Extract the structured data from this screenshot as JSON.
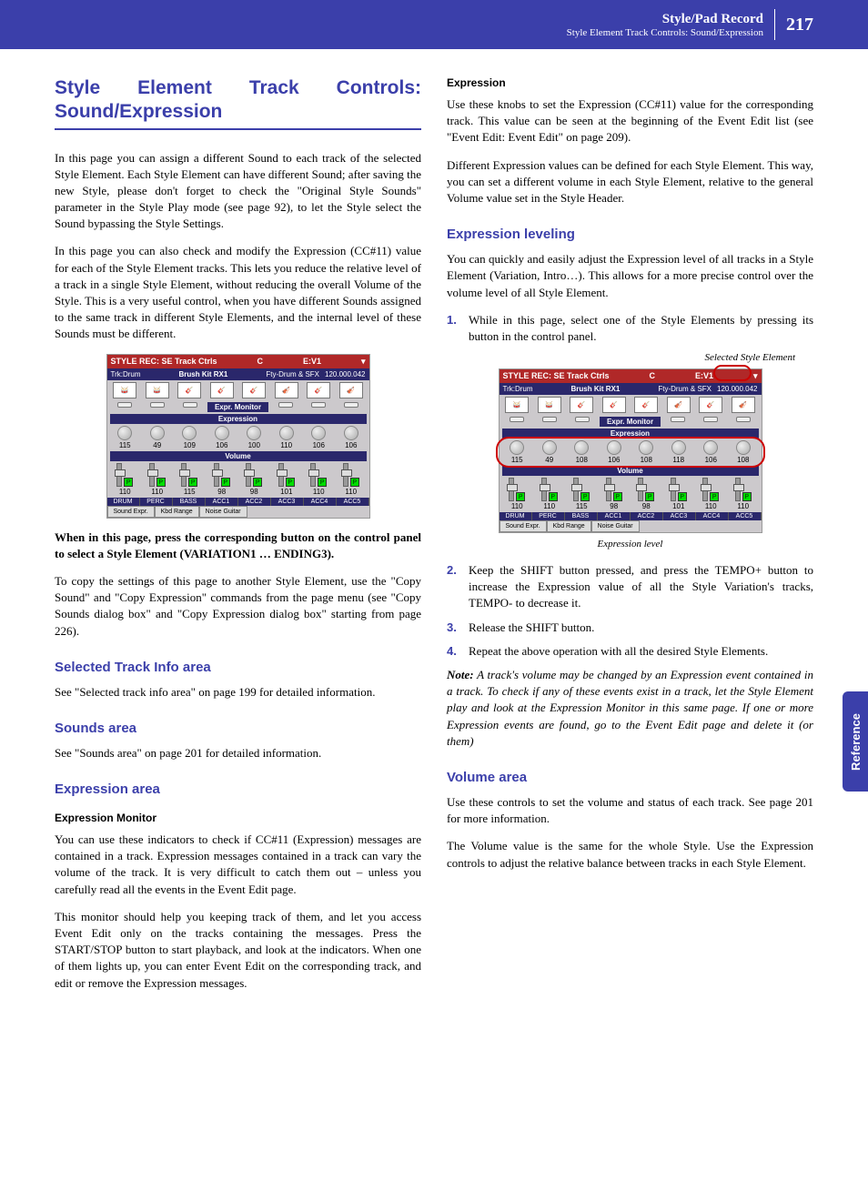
{
  "header": {
    "title": "Style/Pad Record",
    "subtitle": "Style Element Track Controls: Sound/Expression",
    "page": "217"
  },
  "side_tab": "Reference",
  "left": {
    "h1": "Style Element Track Controls: Sound/Expression",
    "p1": "In this page you can assign a different Sound to each track of the selected Style Element. Each Style Element can have different Sound; after saving the new Style, please don't forget to check the \"Original Style Sounds\" parameter in the Style Play mode (see page 92), to let the Style select the Sound bypassing the Style Settings.",
    "p2": "In this page you can also check and modify the Expression (CC#11) value for each of the Style Element tracks. This lets you reduce the relative level of a track in a single Style Element, without reducing the overall Volume of the Style. This is a very useful control, when you have different Sounds assigned to the same track in different Style Elements, and the internal level of these Sounds must be different.",
    "p3_bold": "When in this page, press the corresponding button on the control panel to select a Style Element (VARIATION1 … ENDING3).",
    "p4": "To copy the settings of this page to another Style Element, use the \"Copy Sound\" and \"Copy Expression\" commands from the page menu (see \"Copy Sounds dialog box\" and \"Copy Expression dialog box\" starting from page 226).",
    "h2a": "Selected Track Info area",
    "p5": "See \"Selected track info area\" on page 199 for detailed information.",
    "h2b": "Sounds area",
    "p6": "See \"Sounds area\" on page 201 for detailed information.",
    "h2c": "Expression area",
    "h3a": "Expression Monitor",
    "p7": "You can use these indicators to check if CC#11 (Expression) messages are contained in a track. Expression messages contained in a track can vary the volume of the track. It is very difficult to catch them out – unless you carefully read all the events in the Event Edit page.",
    "p8": "This monitor should help you keeping track of them, and let you access Event Edit only on the tracks containing the messages. Press the START/STOP button to start playback, and look at the indicators. When one of them lights up, you can enter Event Edit on the corresponding track, and edit or remove the Expression messages."
  },
  "right": {
    "h3a": "Expression",
    "p1": "Use these knobs to set the Expression (CC#11) value for the corresponding track. This value can be seen at the beginning of the Event Edit list (see \"Event Edit: Event Edit\" on page 209).",
    "p2": "Different Expression values can be defined for each Style Element. This way, you can set a different volume in each Style Element, relative to the general Volume value set in the Style Header.",
    "h2a": "Expression leveling",
    "p3": "You can quickly and easily adjust the Expression level of all tracks in a Style Element (Variation, Intro…). This allows for a more precise control over the volume level of all Style Element.",
    "step1": "While in this page, select one of the Style Elements by pressing its button in the control panel.",
    "callout_top": "Selected Style Element",
    "callout_bottom": "Expression level",
    "step2": "Keep the SHIFT button pressed, and press the TEMPO+ button to increase the Expression value of all the Style Variation's tracks, TEMPO- to decrease it.",
    "step3": "Release the SHIFT button.",
    "step4": "Repeat the above operation with all the desired Style Elements.",
    "note_label": "Note:",
    "note": " A track's volume may be changed by an Expression event contained in a track. To check if any of these events exist in a track, let the Style Element play and look at the Expression Monitor in this same page. If one or more Expression events are found, go to the Event Edit page and delete it (or them)",
    "h2b": "Volume area",
    "p4": "Use these controls to set the volume and status of each track. See page 201 for more information.",
    "p5": "The Volume value is the same for the whole Style. Use the Expression controls to adjust the relative balance between tracks in each Style Element."
  },
  "screen": {
    "title_left": "STYLE REC: SE Track Ctrls",
    "title_c": "C",
    "title_e": "E:V1",
    "trk": "Trk:Drum",
    "kit": "Brush Kit RX1",
    "fty": "Fty-Drum & SFX",
    "bpm": "120.000.042",
    "band_mon": "Expr. Monitor",
    "band_expr": "Expression",
    "band_vol": "Volume",
    "expr_vals": [
      "115",
      "49",
      "109",
      "106",
      "100",
      "110",
      "106",
      "106"
    ],
    "expr_vals2": [
      "115",
      "49",
      "108",
      "106",
      "108",
      "118",
      "106",
      "108"
    ],
    "vol_vals": [
      "110",
      "110",
      "115",
      "98",
      "98",
      "101",
      "110",
      "110"
    ],
    "track_labels": [
      "DRUM",
      "PERC",
      "BASS",
      "ACC1",
      "ACC2",
      "ACC3",
      "ACC4",
      "ACC5"
    ],
    "tabs": [
      "Sound Expr.",
      "Kbd Range",
      "Noise Guitar"
    ]
  }
}
